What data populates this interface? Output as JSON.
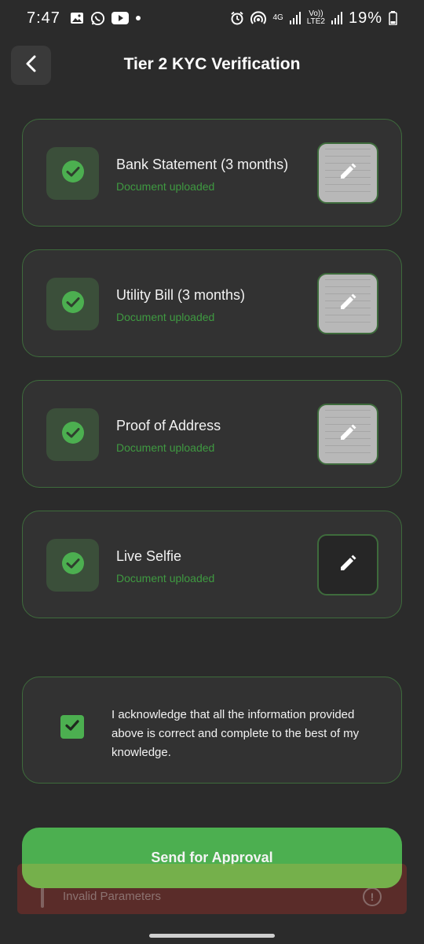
{
  "status_bar": {
    "time": "7:47",
    "left_icons": [
      "gallery-icon",
      "whatsapp-icon",
      "youtube-icon",
      "dot-icon"
    ],
    "right_icons": [
      "alarm-icon",
      "hotspot-icon",
      "signal-icon",
      "signal-icon",
      "battery-icon"
    ],
    "network_4g": "4G",
    "volte_top": "Vo))",
    "volte_bottom": "LTE2",
    "battery_percent": "19%"
  },
  "header": {
    "title": "Tier 2 KYC Verification",
    "back_icon": "chevron-left-icon"
  },
  "documents": [
    {
      "title": "Bank Statement (3 months)",
      "status": "Document uploaded",
      "thumb": "light"
    },
    {
      "title": "Utility Bill (3 months)",
      "status": "Document uploaded",
      "thumb": "light"
    },
    {
      "title": "Proof of Address",
      "status": "Document uploaded",
      "thumb": "light"
    },
    {
      "title": "Live Selfie",
      "status": "Document uploaded",
      "thumb": "dark"
    }
  ],
  "acknowledgement": {
    "checked": true,
    "text": "I acknowledge that all the information provided above is correct and complete to the best of my knowledge."
  },
  "submit": {
    "label": "Send for Approval"
  },
  "toast": {
    "message": "Invalid Parameters",
    "icon_symbol": "!"
  },
  "colors": {
    "background": "#2b2b2b",
    "card": "#323232",
    "card_border": "#3e6b3c",
    "accent_green": "#4caf50",
    "status_green": "#3f9a41",
    "error_toast": "#822d28"
  }
}
